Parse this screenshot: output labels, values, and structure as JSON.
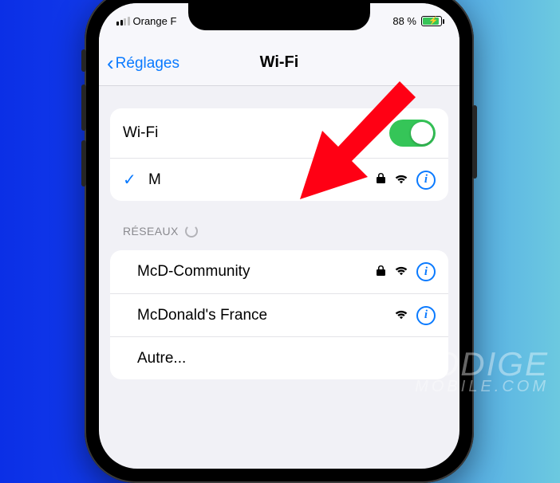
{
  "status": {
    "carrier": "Orange F",
    "battery_pct": "88 %"
  },
  "nav": {
    "back_label": "Réglages",
    "title": "Wi-Fi"
  },
  "wifi_section": {
    "toggle_label": "Wi-Fi",
    "toggle_on": true,
    "connected_network": "M"
  },
  "networks": {
    "header": "RÉSEAUX",
    "items": [
      {
        "name": "McD-Community",
        "locked": true
      },
      {
        "name": "McDonald's France",
        "locked": false
      }
    ],
    "other_label": "Autre..."
  },
  "watermark": {
    "line1": "PRODIGE",
    "line2": "MOBILE.COM"
  }
}
